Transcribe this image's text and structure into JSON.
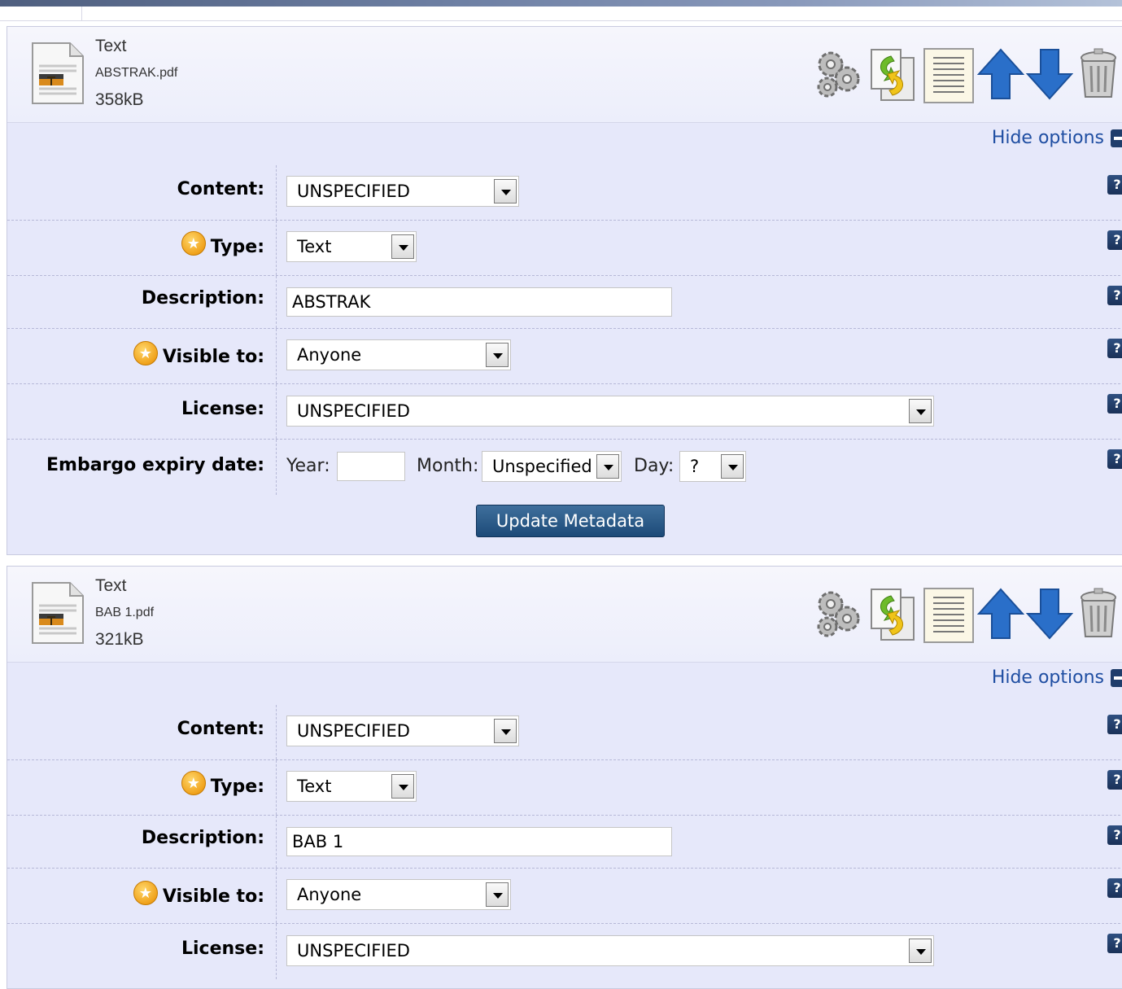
{
  "documents": [
    {
      "file_type": "Text",
      "file_name": "ABSTRAK.pdf",
      "file_size": "358kB",
      "hide_options": "Hide options",
      "fields": {
        "content": {
          "label": "Content:",
          "value": "UNSPECIFIED"
        },
        "type": {
          "label": "Type:",
          "value": "Text"
        },
        "description": {
          "label": "Description:",
          "value": "ABSTRAK"
        },
        "visible": {
          "label": "Visible to:",
          "value": "Anyone"
        },
        "license": {
          "label": "License:",
          "value": "UNSPECIFIED"
        },
        "embargo": {
          "label": "Embargo expiry date:",
          "year_label": "Year:",
          "year_value": "",
          "month_label": "Month:",
          "month_value": "Unspecified",
          "day_label": "Day:",
          "day_value": "?"
        }
      },
      "update_button": "Update Metadata"
    },
    {
      "file_type": "Text",
      "file_name": "BAB 1.pdf",
      "file_size": "321kB",
      "hide_options": "Hide options",
      "fields": {
        "content": {
          "label": "Content:",
          "value": "UNSPECIFIED"
        },
        "type": {
          "label": "Type:",
          "value": "Text"
        },
        "description": {
          "label": "Description:",
          "value": "BAB 1"
        },
        "visible": {
          "label": "Visible to:",
          "value": "Anyone"
        },
        "license": {
          "label": "License:",
          "value": "UNSPECIFIED"
        }
      }
    }
  ],
  "icons": {
    "file": "pdf-document-icon",
    "tools": [
      "settings-gears-icon",
      "convert-document-icon",
      "preview-document-icon",
      "move-up-arrow-icon",
      "move-down-arrow-icon",
      "delete-trash-icon"
    ],
    "help": "help-question-icon",
    "required": "required-star-icon"
  },
  "colors": {
    "panel_bg": "#e6e8fa",
    "link": "#1f4ea2",
    "button": "#1c4a78",
    "arrow_blue": "#2a6fc9",
    "star": "#f0a21c"
  }
}
